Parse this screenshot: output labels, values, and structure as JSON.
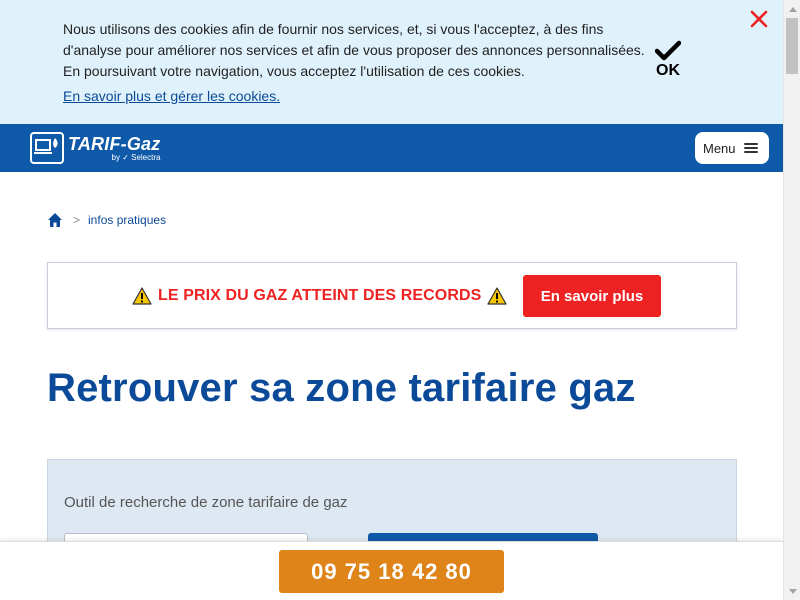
{
  "cookie_banner": {
    "text_line1": "Nous utilisons des cookies afin de fournir nos services, et, si vous l'acceptez, à des fins",
    "text_line2": "d'analyse pour améliorer nos services et afin de vous proposer des annonces personnalisées.",
    "text_line3": "En poursuivant votre navigation, vous acceptez l'utilisation de ces cookies.",
    "link_label": "En savoir plus et gérer les cookies.",
    "ok_label": "OK",
    "close_icon": "close-icon"
  },
  "header": {
    "logo_main": "TARIF-Gaz",
    "logo_sub": "by ✓ Selectra",
    "menu_label": "Menu"
  },
  "breadcrumb": {
    "home_icon": "home-icon",
    "current": "infos pratiques"
  },
  "alert": {
    "text": "LE PRIX DU GAZ ATTEINT DES RECORDS",
    "button_label": "En savoir plus",
    "icon": "warning-icon"
  },
  "page": {
    "title": "Retrouver sa zone tarifaire gaz"
  },
  "tool": {
    "title": "Outil de recherche de zone tarifaire de gaz"
  },
  "phone_bar": {
    "number": "09 75 18 42 80"
  },
  "colors": {
    "brand_blue": "#0f5aa8",
    "title_blue": "#0b4a98",
    "alert_red": "#ee2222",
    "phone_orange": "#df8418",
    "cookie_bg": "#dff1fb"
  }
}
